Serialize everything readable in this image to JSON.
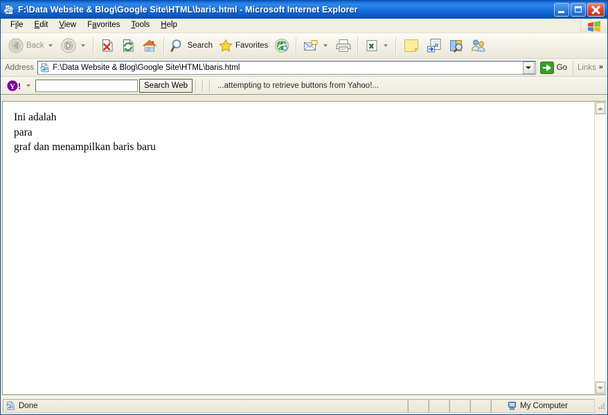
{
  "window": {
    "title": "F:\\Data Website & Blog\\Google Site\\HTML\\baris.html - Microsoft Internet Explorer",
    "title_icon": "ie-page-icon",
    "minimize_label": "Minimize",
    "restore_label": "Restore",
    "close_label": "Close"
  },
  "menu": {
    "items": [
      {
        "pre": "F",
        "key": "i",
        "post": "le"
      },
      {
        "pre": "",
        "key": "E",
        "post": "dit"
      },
      {
        "pre": "",
        "key": "V",
        "post": "iew"
      },
      {
        "pre": "F",
        "key": "a",
        "post": "vorites"
      },
      {
        "pre": "",
        "key": "T",
        "post": "ools"
      },
      {
        "pre": "",
        "key": "H",
        "post": "elp"
      }
    ],
    "logo_icon": "windows-flag-icon"
  },
  "toolbar": {
    "back_label": "Back",
    "back_icon": "back-arrow-icon",
    "forward_icon": "forward-arrow-icon",
    "stop_icon": "stop-icon",
    "refresh_icon": "refresh-icon",
    "home_icon": "home-icon",
    "search_label": "Search",
    "search_icon": "magnifier-icon",
    "favorites_label": "Favorites",
    "favorites_icon": "star-icon",
    "media_icon": "media-globe-icon",
    "mail_icon": "mail-icon",
    "print_icon": "printer-icon",
    "edit_icon": "edit-excel-icon",
    "note_icon": "yellow-note-icon",
    "frontpage_icon": "frontpage-icon",
    "research_icon": "research-icon",
    "messenger_icon": "messenger-icon"
  },
  "address": {
    "label": "Address",
    "icon": "ie-page-icon",
    "value": "F:\\Data Website & Blog\\Google Site\\HTML\\baris.html",
    "dropdown_icon": "chevron-down-icon",
    "go_label": "Go",
    "go_icon": "green-go-arrow-icon",
    "links_label": "Links",
    "links_chevron": "»"
  },
  "yahoo_toolbar": {
    "logo_icon": "yahoo-logo-icon",
    "dropdown_icon": "chevron-down-icon",
    "search_value": "",
    "search_placeholder": "",
    "search_button_label": "Search Web",
    "status_text": "...attempting to retrieve buttons from Yahoo!..."
  },
  "page_content": {
    "lines": [
      "Ini adalah",
      "para",
      "graf dan menampilkan baris baru"
    ]
  },
  "scrollbar": {
    "up_icon": "arrow-up-icon",
    "down_icon": "arrow-down-icon"
  },
  "statusbar": {
    "status_icon": "ie-page-icon",
    "status_text": "Done",
    "zone_icon": "my-computer-icon",
    "zone_text": "My Computer",
    "grip_icon": "resize-grip-icon"
  },
  "colors": {
    "title_bar_blue": "#1a6fdc",
    "close_red": "#c12e1d",
    "chrome_beige": "#ece9d8",
    "go_green": "#3a9e28",
    "yahoo_purple": "#7b0099"
  }
}
